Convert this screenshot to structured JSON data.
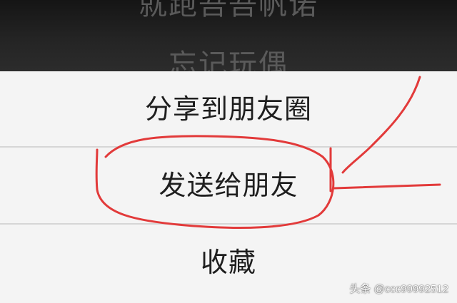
{
  "background": {
    "items": [
      "就跑吾吾帆诺",
      "忘记玩偶"
    ]
  },
  "menu": {
    "items": [
      {
        "label": "分享到朋友圈"
      },
      {
        "label": "发送给朋友"
      },
      {
        "label": "收藏"
      }
    ]
  },
  "annotation": {
    "color": "#e23a3a",
    "highlighted": "发送给朋友"
  },
  "watermark": {
    "text": "头条 @ccc99992512"
  }
}
